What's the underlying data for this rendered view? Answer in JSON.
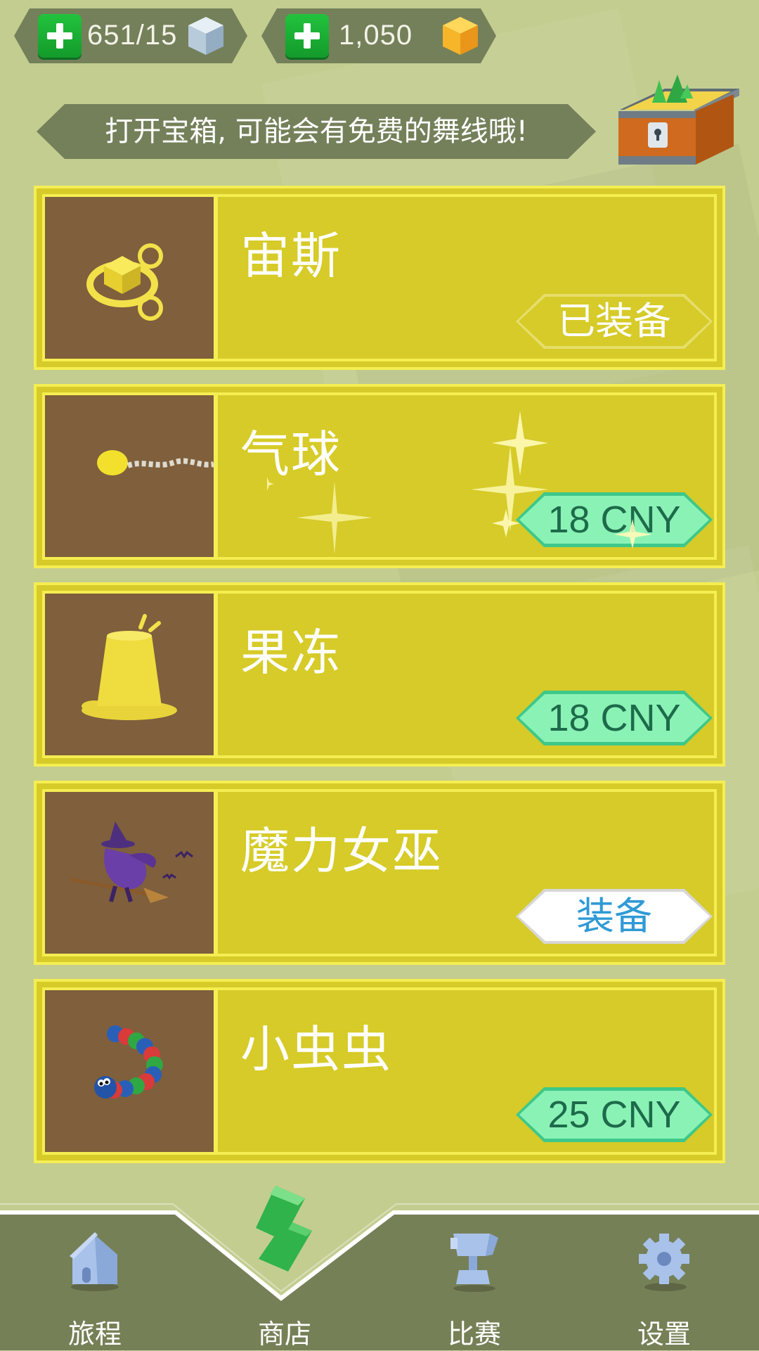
{
  "resources": {
    "cubes": {
      "value": "651/15",
      "icon": "ice-cube-icon"
    },
    "gems": {
      "value": "1,050",
      "icon": "gold-gem-icon"
    }
  },
  "banner": {
    "text": "打开宝箱, 可能会有免费的舞线哦!"
  },
  "items": [
    {
      "name": "宙斯",
      "status": "已装备",
      "status_type": "equipped"
    },
    {
      "name": "气球",
      "price": "18 CNY",
      "status_type": "price"
    },
    {
      "name": "果冻",
      "price": "18 CNY",
      "status_type": "price"
    },
    {
      "name": "魔力女巫",
      "status": "装备",
      "status_type": "equip"
    },
    {
      "name": "小虫虫",
      "price": "25 CNY",
      "status_type": "price"
    }
  ],
  "nav": [
    {
      "label": "旅程",
      "icon": "house-icon"
    },
    {
      "label": "商店",
      "icon": "shop-icon",
      "active": true
    },
    {
      "label": "比赛",
      "icon": "trophy-icon"
    },
    {
      "label": "设置",
      "icon": "gear-icon"
    }
  ],
  "colors": {
    "background": "#c3cd90",
    "card": "#d6cb28",
    "card_border": "#f5ee52",
    "price_button": "#8bf2b6",
    "nav_bar": "#768057"
  }
}
